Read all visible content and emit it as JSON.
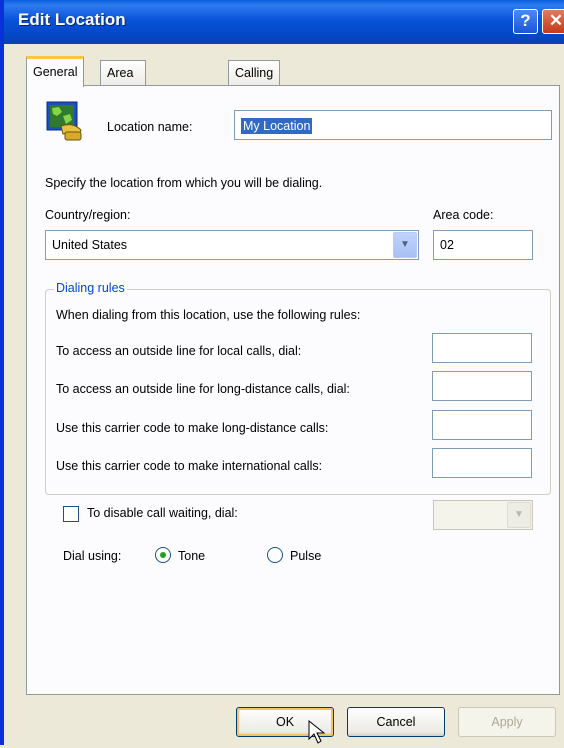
{
  "window": {
    "title": "Edit Location"
  },
  "titlebar_buttons": {
    "help": "?",
    "close": "✕"
  },
  "tabs": [
    {
      "label": "General",
      "active": true
    },
    {
      "label": "Area Code Rules",
      "active": false
    },
    {
      "label": "Calling Card",
      "active": false
    }
  ],
  "general": {
    "location_name_label": "Location name:",
    "location_name_value": "My Location",
    "specify_text": "Specify the location from which you will be dialing.",
    "country_label": "Country/region:",
    "country_value": "United States",
    "area_code_label": "Area code:",
    "area_code_value": "02",
    "dialing_rules": {
      "legend": "Dialing rules",
      "intro": "When dialing from this location, use the following rules:",
      "rules": [
        {
          "label": "To access an outside line for local calls, dial:",
          "value": ""
        },
        {
          "label": "To access an outside line for long-distance calls, dial:",
          "value": ""
        },
        {
          "label": "Use this carrier code to make long-distance calls:",
          "value": ""
        },
        {
          "label": "Use this carrier code to make international calls:",
          "value": ""
        }
      ]
    },
    "call_waiting": {
      "label": "To disable call waiting, dial:",
      "checked": false,
      "value": ""
    },
    "dial_using": {
      "label": "Dial using:",
      "tone": "Tone",
      "pulse": "Pulse",
      "selected": "Tone"
    }
  },
  "buttons": {
    "ok": "OK",
    "cancel": "Cancel",
    "apply": "Apply"
  },
  "colors": {
    "titlebar": "#0853D8",
    "selection": "#316AC5",
    "group_legend": "#0046D5",
    "tab_highlight": "#FFC83C"
  },
  "icons": {
    "location": "globe-phone-icon",
    "dropdown": "chevron-down-icon",
    "cursor": "mouse-pointer-icon"
  }
}
